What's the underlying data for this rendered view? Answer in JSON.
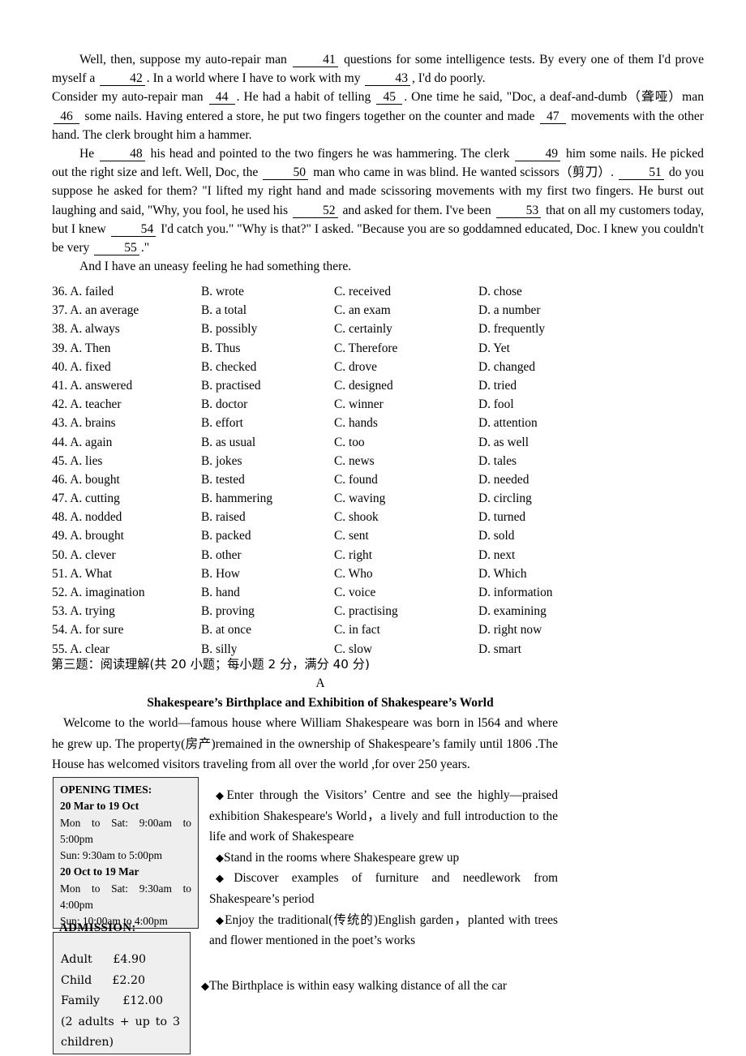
{
  "cloze": {
    "paragraphs": [
      {
        "indent": true,
        "segments": [
          {
            "t": "text",
            "v": "Well, then, suppose my auto-repair man "
          },
          {
            "t": "blank",
            "v": "41"
          },
          {
            "t": "text",
            "v": " questions for some intelligence tests. By every one of them I'd prove myself a "
          },
          {
            "t": "blank",
            "v": "42"
          },
          {
            "t": "text",
            "v": ". In a world where I have to work with my "
          },
          {
            "t": "blank",
            "v": "43"
          },
          {
            "t": "text",
            "v": ", I'd do poorly."
          }
        ]
      },
      {
        "indent": false,
        "segments": [
          {
            "t": "text",
            "v": "Consider my auto-repair man "
          },
          {
            "t": "blank",
            "v": "44"
          },
          {
            "t": "text",
            "v": ". He had a habit of telling "
          },
          {
            "t": "blank",
            "v": "45"
          },
          {
            "t": "text",
            "v": ". One time he said, \"Doc, a deaf-and-dumb（聋哑）man "
          },
          {
            "t": "blank",
            "v": "46"
          },
          {
            "t": "text",
            "v": " some nails. Having entered a store, he put two fingers together on the counter and made "
          },
          {
            "t": "blank",
            "v": "47"
          },
          {
            "t": "text",
            "v": " movements with the other hand. The clerk brought him a hammer."
          }
        ]
      },
      {
        "indent": true,
        "segments": [
          {
            "t": "text",
            "v": "He "
          },
          {
            "t": "blank",
            "v": "48"
          },
          {
            "t": "text",
            "v": " his head and pointed to the two fingers he was hammering. The clerk "
          },
          {
            "t": "blank",
            "v": "49"
          },
          {
            "t": "text",
            "v": " him some nails. He picked out the right size and left. Well, Doc, the "
          },
          {
            "t": "blank",
            "v": "50"
          },
          {
            "t": "text",
            "v": " man who came in was blind. He wanted scissors（剪刀）. "
          },
          {
            "t": "blank",
            "v": "51"
          },
          {
            "t": "text",
            "v": " do you suppose he asked for them? \"I lifted my right hand and made scissoring movements with my first two fingers. He burst out laughing and said, \"Why, you fool, he used his "
          },
          {
            "t": "blank",
            "v": "52"
          },
          {
            "t": "text",
            "v": " and asked for them. I've been "
          },
          {
            "t": "blank",
            "v": "53"
          },
          {
            "t": "text",
            "v": " that on all my customers today, but I knew "
          },
          {
            "t": "blank",
            "v": "54"
          },
          {
            "t": "text",
            "v": " I'd catch you.\" \"Why is that?\" I asked. \"Because you are so goddamned educated, Doc. I knew you couldn't be very "
          },
          {
            "t": "blank",
            "v": "55"
          },
          {
            "t": "text",
            "v": ".\""
          }
        ]
      },
      {
        "indent": true,
        "segments": [
          {
            "t": "text",
            "v": "And I have an uneasy feeling he had something there."
          }
        ]
      }
    ]
  },
  "options": [
    {
      "num": "36.",
      "a": "A. failed",
      "b": "B. wrote",
      "c": "C. received",
      "d": "D. chose"
    },
    {
      "num": "37.",
      "a": "A. an average",
      "b": "B. a total",
      "c": "C. an exam",
      "d": "D. a number"
    },
    {
      "num": "38.",
      "a": "A. always",
      "b": "B. possibly",
      "c": "C. certainly",
      "d": "D. frequently"
    },
    {
      "num": "39.",
      "a": "A. Then",
      "b": "B. Thus",
      "c": "C. Therefore",
      "d": "D. Yet"
    },
    {
      "num": "40.",
      "a": "A. fixed",
      "b": "B. checked",
      "c": "C. drove",
      "d": "D. changed"
    },
    {
      "num": "41.",
      "a": "A. answered",
      "b": "B. practised",
      "c": "C. designed",
      "d": "D. tried"
    },
    {
      "num": "42.",
      "a": "A. teacher",
      "b": "B. doctor",
      "c": "C. winner",
      "d": "D. fool"
    },
    {
      "num": "43.",
      "a": "A. brains",
      "b": "B. effort",
      "c": "C. hands",
      "d": "D. attention"
    },
    {
      "num": "44.",
      "a": "A. again",
      "b": "B. as usual",
      "c": "C. too",
      "d": "D. as well"
    },
    {
      "num": "45.",
      "a": "A. lies",
      "b": "B. jokes",
      "c": "C. news",
      "d": "D. tales"
    },
    {
      "num": "46.",
      "a": "A. bought",
      "b": "B. tested",
      "c": "C. found",
      "d": "D. needed"
    },
    {
      "num": "47.",
      "a": "A. cutting",
      "b": "B. hammering",
      "c": "C. waving",
      "d": "D. circling"
    },
    {
      "num": "48.",
      "a": "A. nodded",
      "b": "B. raised",
      "c": "C. shook",
      "d": "D. turned"
    },
    {
      "num": "49.",
      "a": "A. brought",
      "b": "B. packed",
      "c": "C. sent",
      "d": "D. sold"
    },
    {
      "num": "50.",
      "a": "A. clever",
      "b": "B. other",
      "c": "C. right",
      "d": "D. next"
    },
    {
      "num": "51.",
      "a": "A. What",
      "b": "B. How",
      "c": "C. Who",
      "d": "D. Which"
    },
    {
      "num": "52.",
      "a": "A. imagination",
      "b": "B. hand",
      "c": "C. voice",
      "d": "D. information"
    },
    {
      "num": "53.",
      "a": "A. trying",
      "b": "B. proving",
      "c": "C. practising",
      "d": "D. examining"
    },
    {
      "num": "54.",
      "a": "A. for sure",
      "b": "B. at once",
      "c": "C. in fact",
      "d": "D. right now"
    },
    {
      "num": "55.",
      "a": "A. clear",
      "b": "B. silly",
      "c": "C. slow",
      "d": "D. smart"
    }
  ],
  "reading": {
    "section_heading": "第三题：阅读理解(共 20 小题；每小题 2 分，满分 40 分)",
    "section_letter": "A",
    "article_title": "Shakespeare’s Birthplace and Exhibition of Shakespeare’s World",
    "intro": "Welcome to the world—famous house where William Shakespeare was born in l564 and where he grew up. The property(房产)remained in the ownership of Shakespeare’s family until 1806 .The House has welcomed visitors traveling from all over the world ,for over 250 years."
  },
  "opening_times": {
    "title": "OPENING TIMES:",
    "season1_label": "20 Mar to 19 Oct",
    "season1_weekday": "Mon to Sat: 9:00am to",
    "season1_weekday_cont": "5:00pm",
    "season1_sunday": "Sun: 9:30am to 5:00pm",
    "season2_label": "20 Oct to 19 Mar",
    "season2_weekday": "Mon to Sat: 9:30am to",
    "season2_weekday_cont": "4:00pm",
    "season2_sunday": "Sun: 10:00am to 4:00pm"
  },
  "admission": {
    "title": "ADMISSION:",
    "adult_label": "Adult",
    "adult_price": "£4.90",
    "child_label": "Child",
    "child_price": "£2.20",
    "family_label": "Family",
    "family_price": "£12.00",
    "note_line1": "(2 adults + up to 3",
    "note_line2": "children)"
  },
  "bullets": {
    "marker": "◆",
    "items": [
      "Enter through the Visitors’ Centre and see the highly—praised exhibition Shakespeare's World，a lively and full introduction to the life and work of Shakespeare",
      "Stand in the rooms where Shakespeare grew up",
      "Discover examples of furniture and needlework from Shakespeare’s period",
      "Enjoy the traditional(传统的)English garden，planted with trees and flower mentioned in the poet’s works"
    ],
    "last_item": "The Birthplace is within easy walking distance of all the car"
  }
}
